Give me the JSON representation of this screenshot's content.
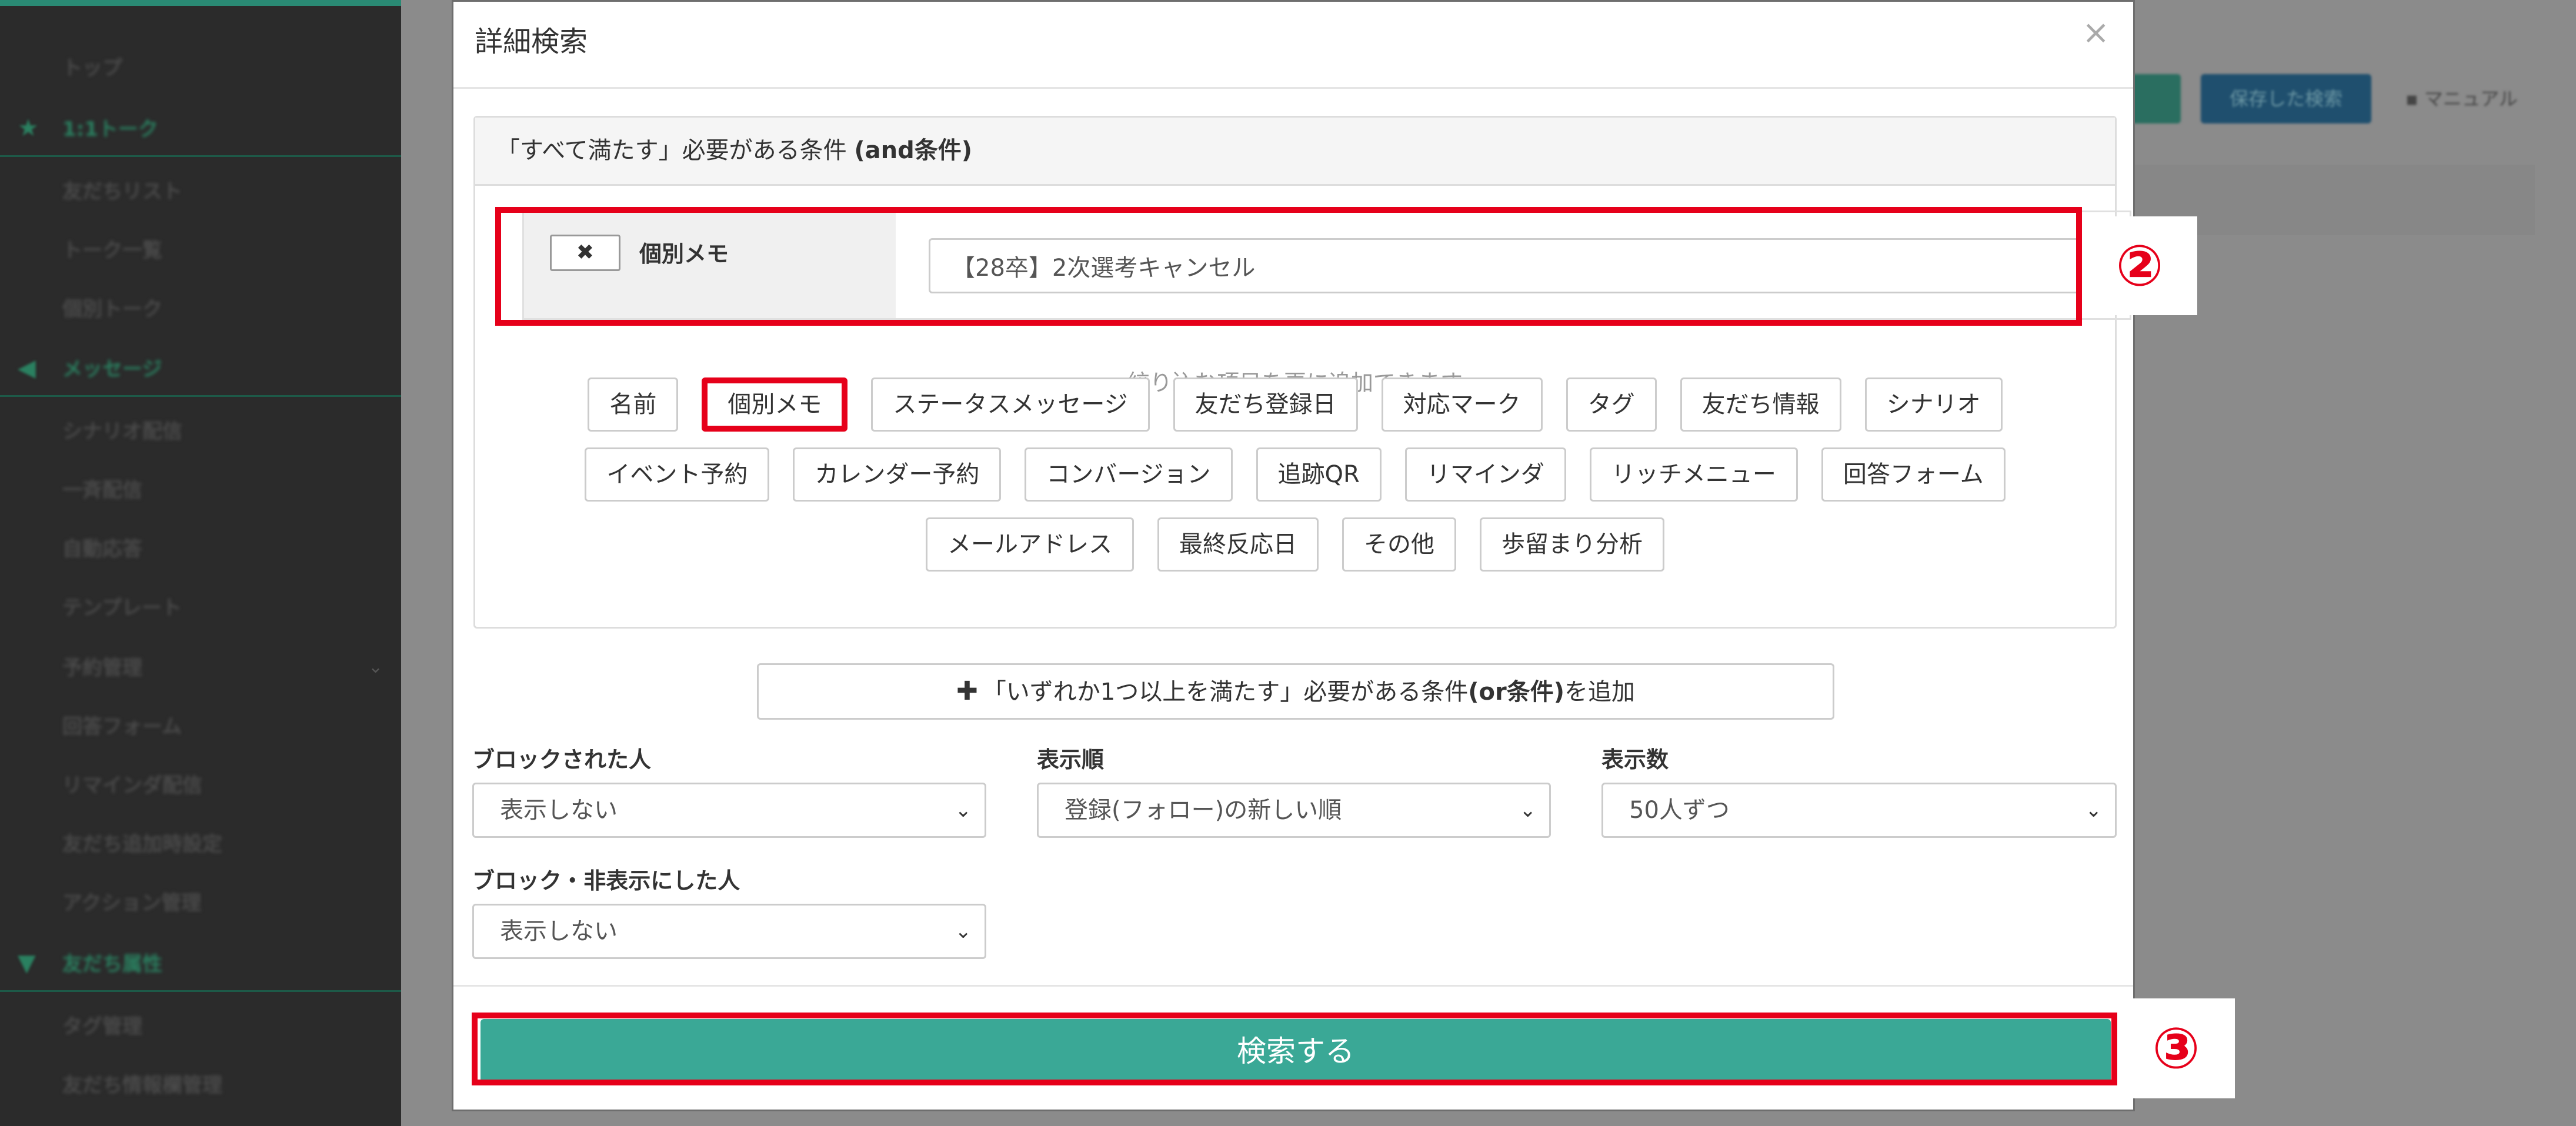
{
  "sidebar": {
    "items": [
      {
        "label": "トップ",
        "kind": "item"
      },
      {
        "label": "1:1トーク",
        "kind": "section",
        "icon": "star-icon"
      },
      {
        "label": "友だちリスト",
        "kind": "item"
      },
      {
        "label": "トーク一覧",
        "kind": "item"
      },
      {
        "label": "個別トーク",
        "kind": "item"
      },
      {
        "label": "メッセージ",
        "kind": "section",
        "icon": "megaphone-icon"
      },
      {
        "label": "シナリオ配信",
        "kind": "item"
      },
      {
        "label": "一斉配信",
        "kind": "item"
      },
      {
        "label": "自動応答",
        "kind": "item"
      },
      {
        "label": "テンプレート",
        "kind": "item"
      },
      {
        "label": "予約管理",
        "kind": "item"
      },
      {
        "label": "回答フォーム",
        "kind": "item"
      },
      {
        "label": "リマインダ配信",
        "kind": "item"
      },
      {
        "label": "友だち追加時設定",
        "kind": "item"
      },
      {
        "label": "アクション管理",
        "kind": "item"
      },
      {
        "label": "友だち属性",
        "kind": "section",
        "icon": "filter-icon"
      },
      {
        "label": "タグ管理",
        "kind": "item"
      },
      {
        "label": "友だち情報欄管理",
        "kind": "item"
      }
    ]
  },
  "background": {
    "saved_search_label": "保存した検索",
    "manual_label": "マニュアル"
  },
  "modal": {
    "title": "詳細検索",
    "close_icon": "×",
    "and_panel": {
      "prefix": "「すべて満たす」必要がある条件 ",
      "bold": "(and条件)"
    },
    "condition": {
      "remove_icon": "✖",
      "label": "個別メモ",
      "value": "【28卒】2次選考キャンセル"
    },
    "hint": "絞り込む項目を更に追加できます",
    "chip_rows": [
      [
        "名前",
        "個別メモ",
        "ステータスメッセージ",
        "友だち登録日",
        "対応マーク",
        "タグ",
        "友だち情報",
        "シナリオ"
      ],
      [
        "イベント予約",
        "カレンダー予約",
        "コンバージョン",
        "追跡QR",
        "リマインダ",
        "リッチメニュー",
        "回答フォーム"
      ],
      [
        "メールアドレス",
        "最終反応日",
        "その他",
        "歩留まり分析"
      ]
    ],
    "highlighted_chip": "個別メモ",
    "or_button": {
      "plus": "✚",
      "prefix": "「いずれか1つ以上を満たす」必要がある条件",
      "bold": "(or条件)",
      "suffix": "を追加"
    },
    "filters": {
      "blocked_label": "ブロックされた人",
      "blocked_value": "表示しない",
      "order_label": "表示順",
      "order_value": "登録(フォロー)の新しい順",
      "count_label": "表示数",
      "count_value": "50人ずつ",
      "hidden_label": "ブロック・非表示にした人",
      "hidden_value": "表示しない"
    },
    "search_button": "検索する"
  },
  "annotations": {
    "step2": "②",
    "step3": "③",
    "color": "#e6001a"
  },
  "colors": {
    "accent": "#3aa896",
    "sidebar_bg": "#2b2b2b"
  }
}
